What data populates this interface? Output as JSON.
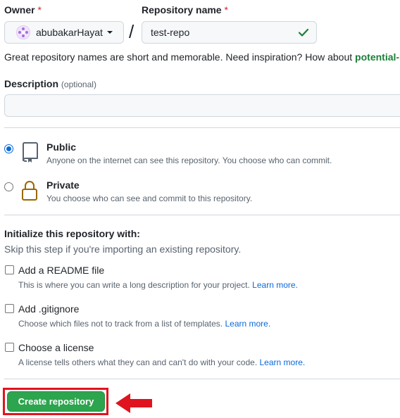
{
  "owner": {
    "label": "Owner",
    "required_mark": "*",
    "value": "abubakarHayat"
  },
  "separator": "/",
  "repo_name": {
    "label": "Repository name",
    "required_mark": "*",
    "value": "test-repo"
  },
  "hint": {
    "text": "Great repository names are short and memorable. Need inspiration? How about ",
    "suggestion": "potential-r"
  },
  "description": {
    "label": "Description",
    "optional": "(optional)",
    "value": ""
  },
  "visibility": {
    "options": [
      {
        "title": "Public",
        "desc": "Anyone on the internet can see this repository. You choose who can commit.",
        "checked": true
      },
      {
        "title": "Private",
        "desc": "You choose who can see and commit to this repository.",
        "checked": false
      }
    ]
  },
  "init": {
    "heading": "Initialize this repository with:",
    "subheading": "Skip this step if you're importing an existing repository.",
    "items": [
      {
        "title": "Add a README file",
        "desc": "This is where you can write a long description for your project.",
        "link": "Learn more."
      },
      {
        "title": "Add .gitignore",
        "desc": "Choose which files not to track from a list of templates.",
        "link": "Learn more."
      },
      {
        "title": "Choose a license",
        "desc": "A license tells others what they can and can't do with your code.",
        "link": "Learn more."
      }
    ]
  },
  "create_button": "Create repository",
  "colors": {
    "primary_button": "#2da44e",
    "highlight_frame": "#e0141e",
    "arrow": "#e0141e",
    "link": "#0969da",
    "success_check": "#1a7f37"
  }
}
